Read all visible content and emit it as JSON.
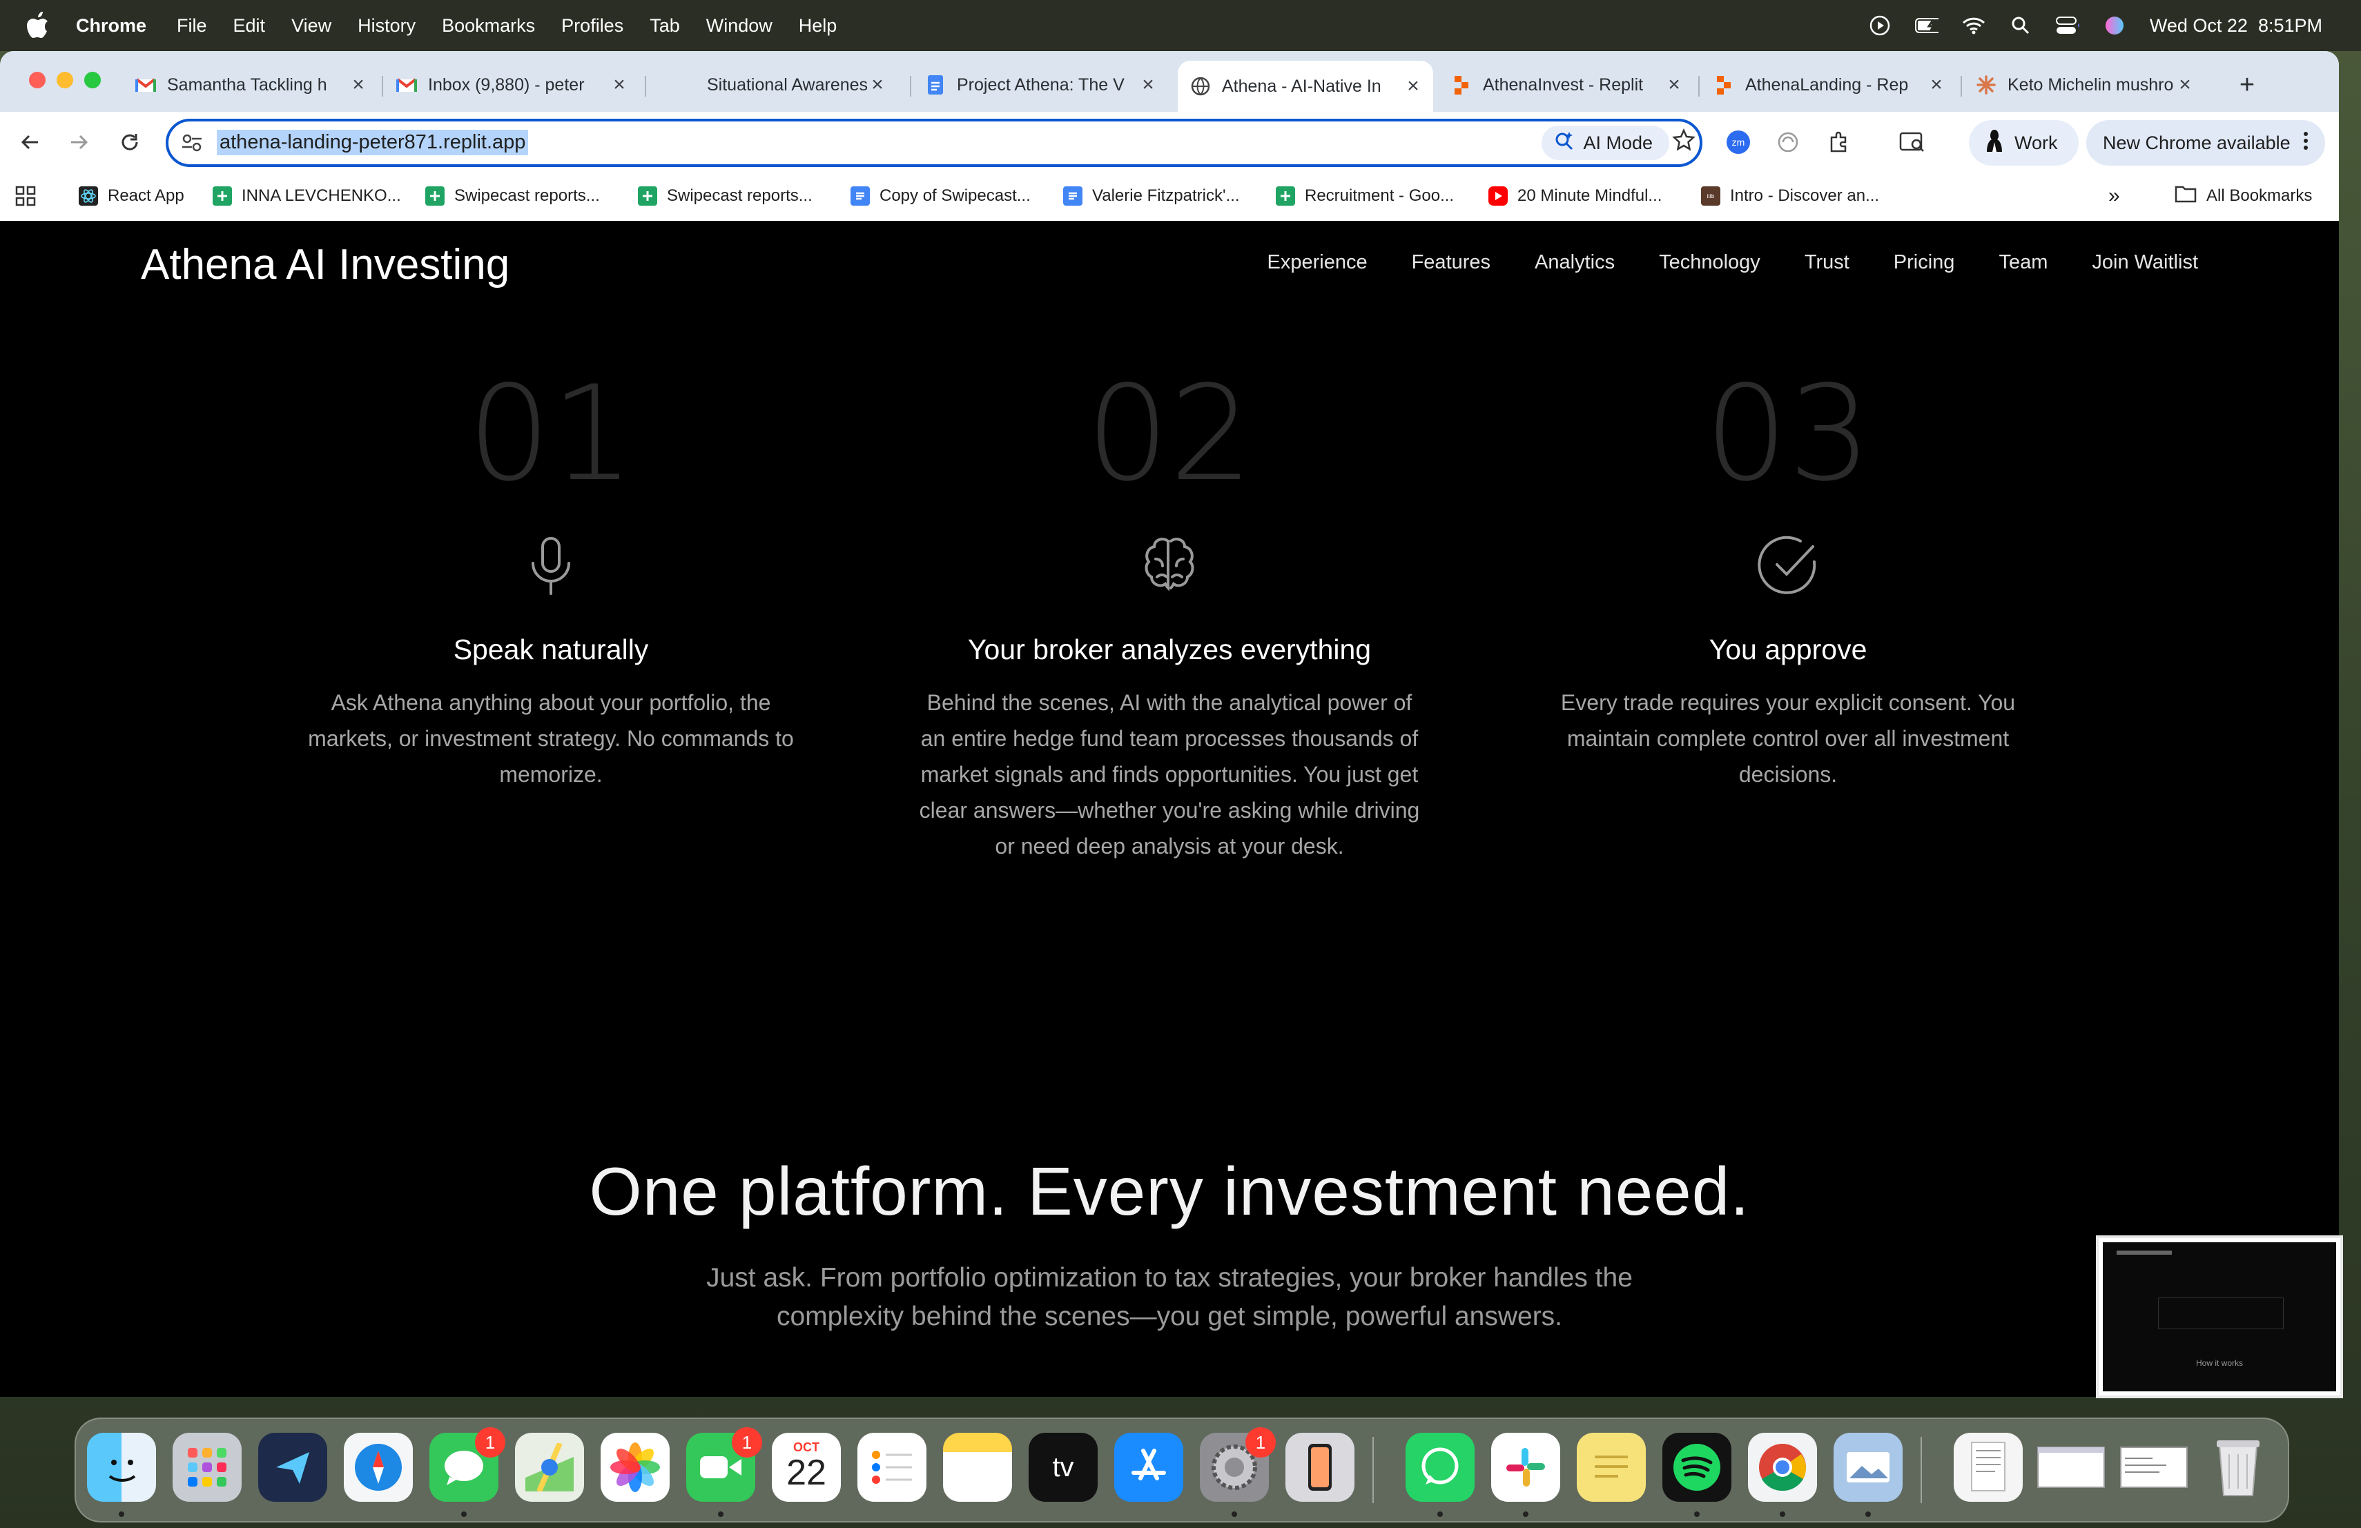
{
  "menubar": {
    "app_name": "Chrome",
    "menus": [
      "File",
      "Edit",
      "View",
      "History",
      "Bookmarks",
      "Profiles",
      "Tab",
      "Window",
      "Help"
    ],
    "datetime": "Wed Oct 22  8:51PM"
  },
  "tabs": [
    {
      "title": "Samantha Tackling h",
      "favicon": "gmail-icon"
    },
    {
      "title": "Inbox (9,880) - peter",
      "favicon": "gmail-icon"
    },
    {
      "title": "Situational Awarenes",
      "favicon": "blank-icon"
    },
    {
      "title": "Project Athena: The V",
      "favicon": "docs-icon"
    },
    {
      "title": "Athena - AI-Native In",
      "favicon": "globe-icon",
      "active": true
    },
    {
      "title": "AthenaInvest - Replit",
      "favicon": "replit-icon"
    },
    {
      "title": "AthenaLanding - Rep",
      "favicon": "replit-icon"
    },
    {
      "title": "Keto Michelin mushro",
      "favicon": "claude-icon"
    }
  ],
  "toolbar": {
    "url": "athena-landing-peter871.replit.app",
    "ai_mode_label": "AI Mode",
    "profile_label": "Work",
    "update_label": "New Chrome available"
  },
  "bookmarks": [
    {
      "label": "React App",
      "icon": "react-icon"
    },
    {
      "label": "INNA LEVCHENKO...",
      "icon": "sheets-icon"
    },
    {
      "label": "Swipecast reports...",
      "icon": "sheets-icon"
    },
    {
      "label": "Swipecast reports...",
      "icon": "sheets-icon"
    },
    {
      "label": "Copy of Swipecast...",
      "icon": "docs-icon"
    },
    {
      "label": "Valerie Fitzpatrick'...",
      "icon": "docs-icon"
    },
    {
      "label": "Recruitment - Goo...",
      "icon": "sheets-icon"
    },
    {
      "label": "20 Minute Mindful...",
      "icon": "youtube-icon"
    },
    {
      "label": "Intro - Discover an...",
      "icon": "site-icon"
    }
  ],
  "all_bookmarks_label": "All Bookmarks",
  "site": {
    "brand": "Athena AI Investing",
    "nav": [
      "Experience",
      "Features",
      "Analytics",
      "Technology",
      "Trust",
      "Pricing",
      "Team",
      "Join Waitlist"
    ],
    "steps": [
      {
        "num": "01",
        "icon": "microphone-icon",
        "title": "Speak naturally",
        "text": "Ask Athena anything about your portfolio, the markets, or investment strategy. No commands to memorize."
      },
      {
        "num": "02",
        "icon": "brain-icon",
        "title": "Your broker analyzes everything",
        "text": "Behind the scenes, AI with the analytical power of an entire hedge fund team processes thousands of market signals and finds opportunities. You just get clear answers—whether you're asking while driving or need deep analysis at your desk."
      },
      {
        "num": "03",
        "icon": "check-circle-icon",
        "title": "You approve",
        "text": "Every trade requires your explicit consent. You maintain complete control over all investment decisions."
      }
    ],
    "headline": "One platform. Every investment need.",
    "subheadline": "Just ask. From portfolio optimization to tax strategies, your broker handles the complexity behind the scenes—you get simple, powerful answers."
  },
  "preview": {
    "caption": "How it works"
  },
  "dock": {
    "calendar_month": "OCT",
    "calendar_day": "22",
    "messages_badge": "1",
    "facetime_badge": "1",
    "settings_badge": "1"
  }
}
